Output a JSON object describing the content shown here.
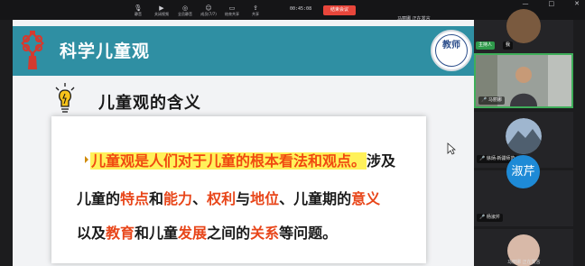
{
  "toolbar": {
    "buttons": [
      {
        "icon": "mic-icon",
        "glyph": "🎙",
        "label": "静音"
      },
      {
        "icon": "video-icon",
        "glyph": "▶",
        "label": "关闭视频"
      },
      {
        "icon": "mute-all-icon",
        "glyph": "◎",
        "label": "全员静音"
      },
      {
        "icon": "members-icon",
        "glyph": "☺",
        "label": "成员(7/7)"
      },
      {
        "icon": "end-share-icon",
        "glyph": "▭",
        "label": "结束共享"
      },
      {
        "icon": "share-icon",
        "glyph": "⇪",
        "label": "共享"
      }
    ],
    "timer": "00:45:08",
    "end_label": "结束会议"
  },
  "window_controls": [
    "—",
    "□",
    "✕"
  ],
  "speaker_bar": "马丽娜  正在发言",
  "slide": {
    "banner_title": "科学儿童观",
    "seal_text": "教师",
    "heading": "儿童观的含义",
    "line1": {
      "highlight": "儿童观是人们对于儿童的根本看法和观点。",
      "rest": "涉及"
    },
    "line2": [
      {
        "text": "儿童的",
        "red": false
      },
      {
        "text": "特点",
        "red": true
      },
      {
        "text": "和",
        "red": false
      },
      {
        "text": "能力",
        "red": true
      },
      {
        "text": "、",
        "red": false
      },
      {
        "text": "权利",
        "red": true
      },
      {
        "text": "与",
        "red": false
      },
      {
        "text": "地位",
        "red": true
      },
      {
        "text": "、儿童期的",
        "red": false
      },
      {
        "text": "意义",
        "red": true
      }
    ],
    "line3": [
      {
        "text": "以及",
        "red": false
      },
      {
        "text": "教育",
        "red": true
      },
      {
        "text": "和儿童",
        "red": false
      },
      {
        "text": "发展",
        "red": true
      },
      {
        "text": "之间的",
        "red": false
      },
      {
        "text": "关系",
        "red": true
      },
      {
        "text": "等问题。",
        "red": false
      }
    ]
  },
  "participants": {
    "host_tag": "主持人",
    "me_tag": "我",
    "speaker_name": "马丽娜",
    "p3_name": "徐炳·新疆师范",
    "p4_avatar": "淑芹",
    "p4_name": "杨淑芹",
    "bottom_status": "马丽娜  正在发言"
  },
  "colors": {
    "banner": "#2f8fa3",
    "accent_red": "#e8461a",
    "highlight_yellow": "#fff15a",
    "end_button": "#e8463b",
    "host_green": "#2f9a4b"
  }
}
